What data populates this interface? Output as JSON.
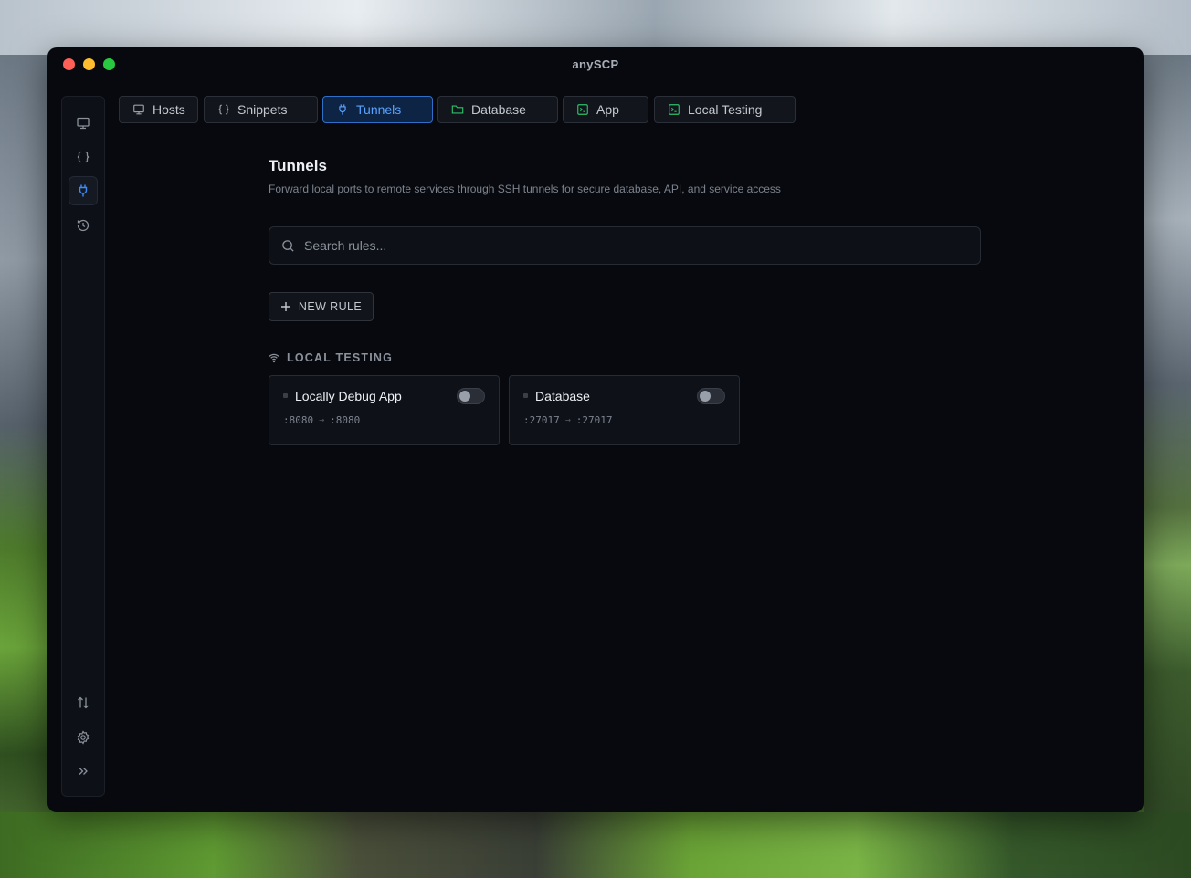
{
  "window": {
    "title": "anySCP"
  },
  "sidebar": {
    "items": [
      {
        "icon": "monitor-icon",
        "name": "hosts"
      },
      {
        "icon": "braces-icon",
        "name": "snippets"
      },
      {
        "icon": "plug-icon",
        "name": "tunnels",
        "active": true
      },
      {
        "icon": "history-icon",
        "name": "history"
      }
    ],
    "bottom": [
      {
        "icon": "transfer-arrows-icon",
        "name": "transfers"
      },
      {
        "icon": "gear-icon",
        "name": "settings"
      },
      {
        "icon": "chevrons-right-icon",
        "name": "expand"
      }
    ]
  },
  "tabs": [
    {
      "label": "Hosts",
      "icon": "monitor-icon"
    },
    {
      "label": "Snippets",
      "icon": "braces-icon"
    },
    {
      "label": "Tunnels",
      "icon": "plug-icon",
      "active": true
    },
    {
      "label": "Database",
      "icon": "folder-icon"
    },
    {
      "label": "App",
      "icon": "terminal-icon"
    },
    {
      "label": "Local Testing",
      "icon": "terminal-icon"
    }
  ],
  "page": {
    "title": "Tunnels",
    "subtitle": "Forward local ports to remote services through SSH tunnels for secure database, API, and service access"
  },
  "search": {
    "placeholder": "Search rules..."
  },
  "new_rule": {
    "label": "NEW RULE"
  },
  "section": {
    "label": "LOCAL TESTING"
  },
  "rules": [
    {
      "name": "Locally Debug App",
      "local_port": ":8080",
      "remote_port": ":8080",
      "enabled": false
    },
    {
      "name": "Database",
      "local_port": ":27017",
      "remote_port": ":27017",
      "enabled": false
    }
  ],
  "colors": {
    "accent": "#3d8bfd",
    "tab_icon_green": "#2fbf6a",
    "background": "#07090e"
  }
}
